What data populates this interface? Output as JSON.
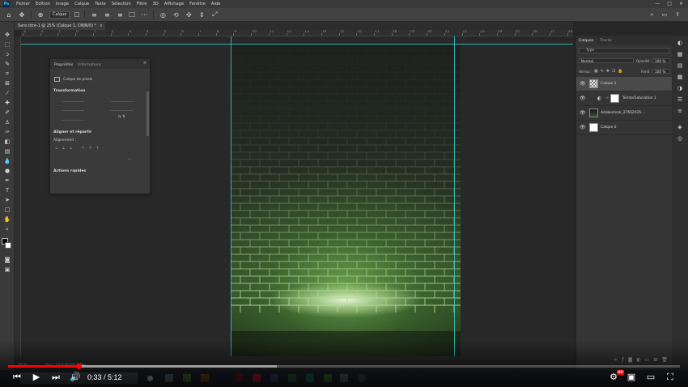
{
  "menubar": {
    "items": [
      "Fichier",
      "Edition",
      "Image",
      "Calque",
      "Texte",
      "Sélection",
      "Filtre",
      "3D",
      "Affichage",
      "Fenêtre",
      "Aide"
    ]
  },
  "optionsbar": {
    "select_label": "Calque"
  },
  "document_tab": {
    "title": "Sans titre-1 @ 25% (Calque 1, CMJN/8) *",
    "close": "×"
  },
  "ruler": {
    "ticks": [
      "3",
      "2",
      "1",
      "0",
      "1",
      "2",
      "3",
      "4",
      "5",
      "6",
      "7",
      "8",
      "9",
      "10",
      "11",
      "12",
      "13",
      "14",
      "15",
      "16",
      "17",
      "18",
      "19",
      "20",
      "21",
      "22",
      "23",
      "24",
      "25",
      "26",
      "27",
      "28"
    ]
  },
  "properties_panel": {
    "tabs": [
      "Propriétés",
      "Informations"
    ],
    "layer_kind": "Calque de pixels",
    "transform_title": "Transformation",
    "align_title": "Aligner et répartir",
    "align_label": "Alignement :",
    "quick_actions_title": "Actions rapides",
    "more": "···"
  },
  "layers_panel": {
    "tabs": [
      "Calques",
      "Tracés"
    ],
    "filter_placeholder": "Type",
    "blend_mode": "Normal",
    "opacity_label": "Opacité :",
    "opacity_value": "100 %",
    "lock_label": "Verrou :",
    "fill_label": "Fond :",
    "fill_value": "100 %",
    "layers": [
      {
        "name": "Calque 1",
        "active": true
      },
      {
        "name": "Teinte/Saturation 1",
        "active": false
      },
      {
        "name": "Adobestock_27662035...",
        "active": false
      },
      {
        "name": "Calque 0",
        "active": false
      }
    ]
  },
  "statusbar": {
    "zoom": "25 %",
    "docinfo": "Doc : 23,9 Mo/50,0 Mo"
  },
  "video": {
    "time": "0:33 / 5:12",
    "progress_fraction": 0.106,
    "loaded_fraction": 0.4
  },
  "colors": {
    "accent_guide": "#36c6c6",
    "yt_red": "#ff0000"
  }
}
